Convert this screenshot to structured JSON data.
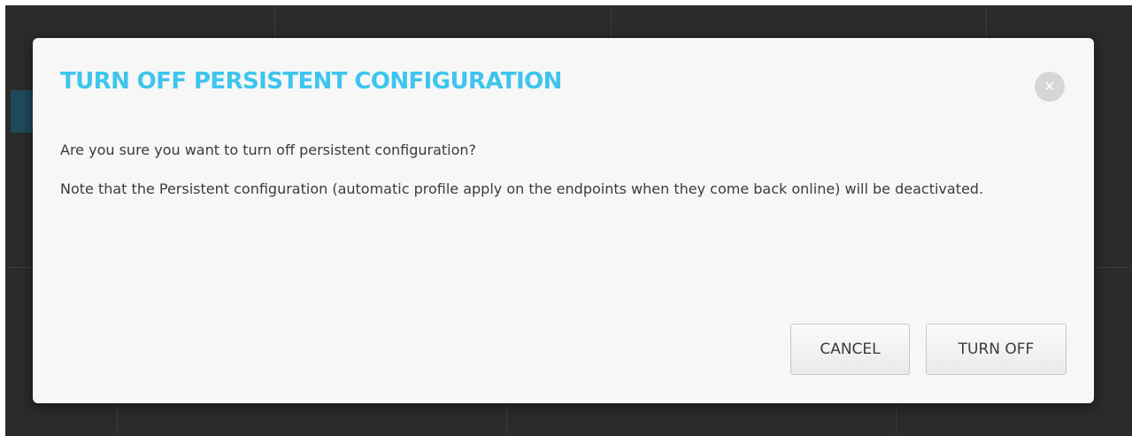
{
  "dialog": {
    "title": "TURN OFF PERSISTENT CONFIGURATION",
    "close_icon": "close-icon",
    "question": "Are you sure you want to turn off persistent configuration?",
    "note": "Note that the Persistent configuration (automatic profile apply on the endpoints when they come back online) will be deactivated."
  },
  "buttons": {
    "cancel_label": "CANCEL",
    "turn_off_label": "TURN OFF"
  },
  "colors": {
    "title": "#3ec5ee",
    "backdrop": "#2b2b2b",
    "modal_bg": "#f7f7f7",
    "text": "#3c3c3c"
  }
}
